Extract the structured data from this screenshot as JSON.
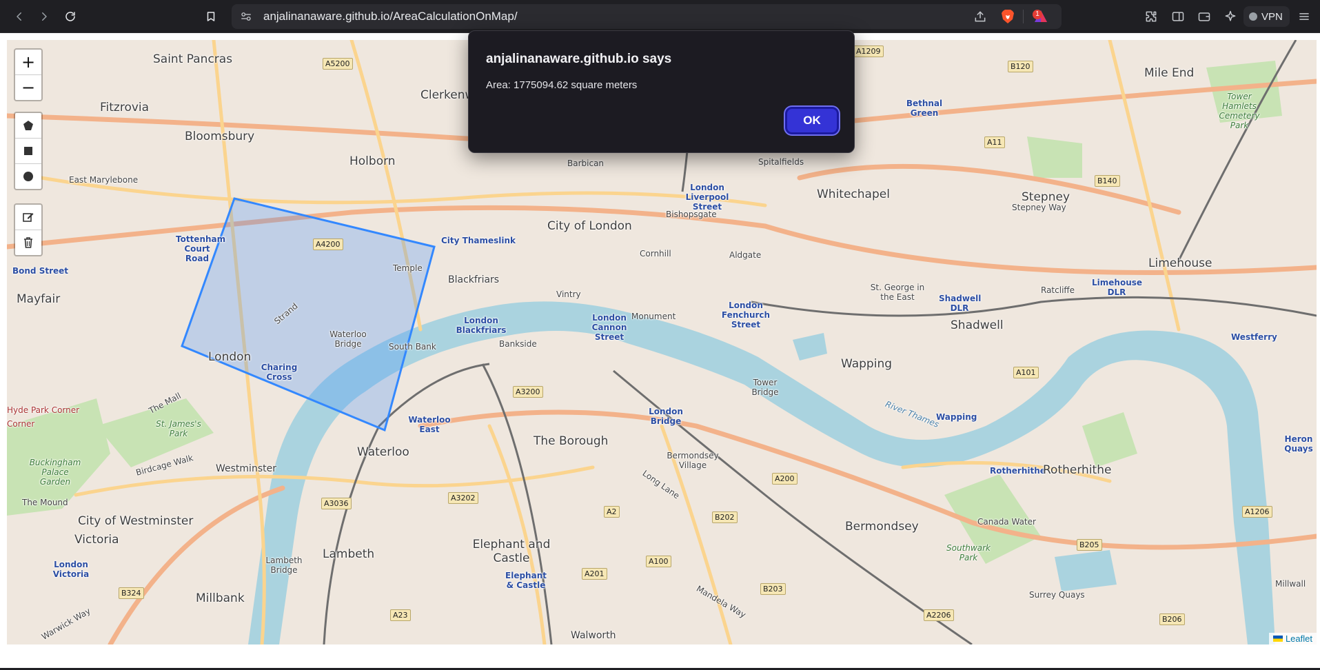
{
  "browser": {
    "url": "anjalinanaware.github.io/AreaCalculationOnMap/",
    "rewards_badge": "1",
    "vpn_label": "VPN"
  },
  "map": {
    "attribution": "Leaflet",
    "zoom_in": "+",
    "zoom_out": "−",
    "places": {
      "saint_pancras": "Saint Pancras",
      "fitzrovia": "Fitzrovia",
      "bloomsbury": "Bloomsbury",
      "east_marylebone": "East Marylebone",
      "holborn": "Holborn",
      "clerkenwell": "Clerkenw",
      "barbican": "Barbican",
      "spitalfields": "Spitalfields",
      "whitechapel": "Whitechapel",
      "stepney": "Stepney",
      "stepney_way": "Stepney Way",
      "mile_end": "Mile End",
      "bethnal_green": "Bethnal Green",
      "tower_hamlets_cemetery": "Tower Hamlets Cemetery Park",
      "city_of_london": "City of London",
      "bishopsgate": "Bishopsgate",
      "london_liverpool": "London Liverpool Street",
      "city_thameslink": "City Thameslink",
      "cornhill": "Cornhill",
      "aldgate": "Aldgate",
      "tottenham_court_road": "Tottenham Court Road",
      "bond_street": "Bond Street",
      "mayfair": "Mayfair",
      "temple": "Temple",
      "blackfriars": "Blackfriars",
      "vintry": "Vintry",
      "monument": "Monument",
      "london_fenchurch": "London Fenchurch Street",
      "st_george": "St. George in the East",
      "shadwell_dlr": "Shadwell DLR",
      "ratcliffe": "Ratcliffe",
      "limehouse_dlr": "Limehouse DLR",
      "limehouse": "Limehouse",
      "shadwell": "Shadwell",
      "strand": "Strand",
      "waterloo_bridge": "Waterloo Bridge",
      "south_bank": "South Bank",
      "london_blackfriars": "London Blackfriars",
      "bankside": "Bankside",
      "london_cannon": "London Cannon Street",
      "london": "London",
      "charing_cross": "Charing Cross",
      "tower_bridge": "Tower Bridge",
      "wapping": "Wapping",
      "wapping_station": "Wapping",
      "westferry": "Westferry",
      "hyde_park_corner": "Hyde Park Corner",
      "corner": "Corner",
      "the_mall": "The Mall",
      "st_james_park": "St. James's Park",
      "london_bridge": "London Bridge",
      "the_borough": "The Borough",
      "waterloo_east": "Waterloo East",
      "waterloo": "Waterloo",
      "bermondsey_village": "Bermondsey Village",
      "rotherhithe_station": "Rotherhithe",
      "rotherhithe": "Rotherhithe",
      "buckingham_palace": "Buckingham Palace Garden",
      "birdcage_walk": "Birdcage Walk",
      "westminster": "Westminster",
      "the_mound": "The Mound",
      "city_of_westminster": "City of Westminster",
      "victoria": "Victoria",
      "london_victoria": "London Victoria",
      "lambeth_bridge": "Lambeth Bridge",
      "lambeth": "Lambeth",
      "elephant_and_castle": "Elephant and Castle",
      "elephant_castle_station": "Elephant & Castle",
      "bermondsey": "Bermondsey",
      "canada_water": "Canada Water",
      "southwark_park": "Southwark Park",
      "surrey_quays": "Surrey Quays",
      "millbank": "Millbank",
      "walworth": "Walworth",
      "heron_quays": "Heron Quays",
      "millwall": "Millwall",
      "long_lane": "Long Lane",
      "mandela_way": "Mandela Way",
      "warwick_way": "Warwick Way",
      "river_thames": "River Thames"
    },
    "roads": [
      "A5200",
      "A4200",
      "A1209",
      "B120",
      "A11",
      "B140",
      "A3200",
      "A101",
      "A200",
      "B202",
      "A2",
      "A100",
      "A201",
      "A3202",
      "A3036",
      "B324",
      "A23",
      "B203",
      "A2206",
      "B205",
      "B206",
      "A1206"
    ]
  },
  "dialog": {
    "title": "anjalinanaware.github.io says",
    "message": "Area: 1775094.62 square meters",
    "ok_label": "OK"
  }
}
